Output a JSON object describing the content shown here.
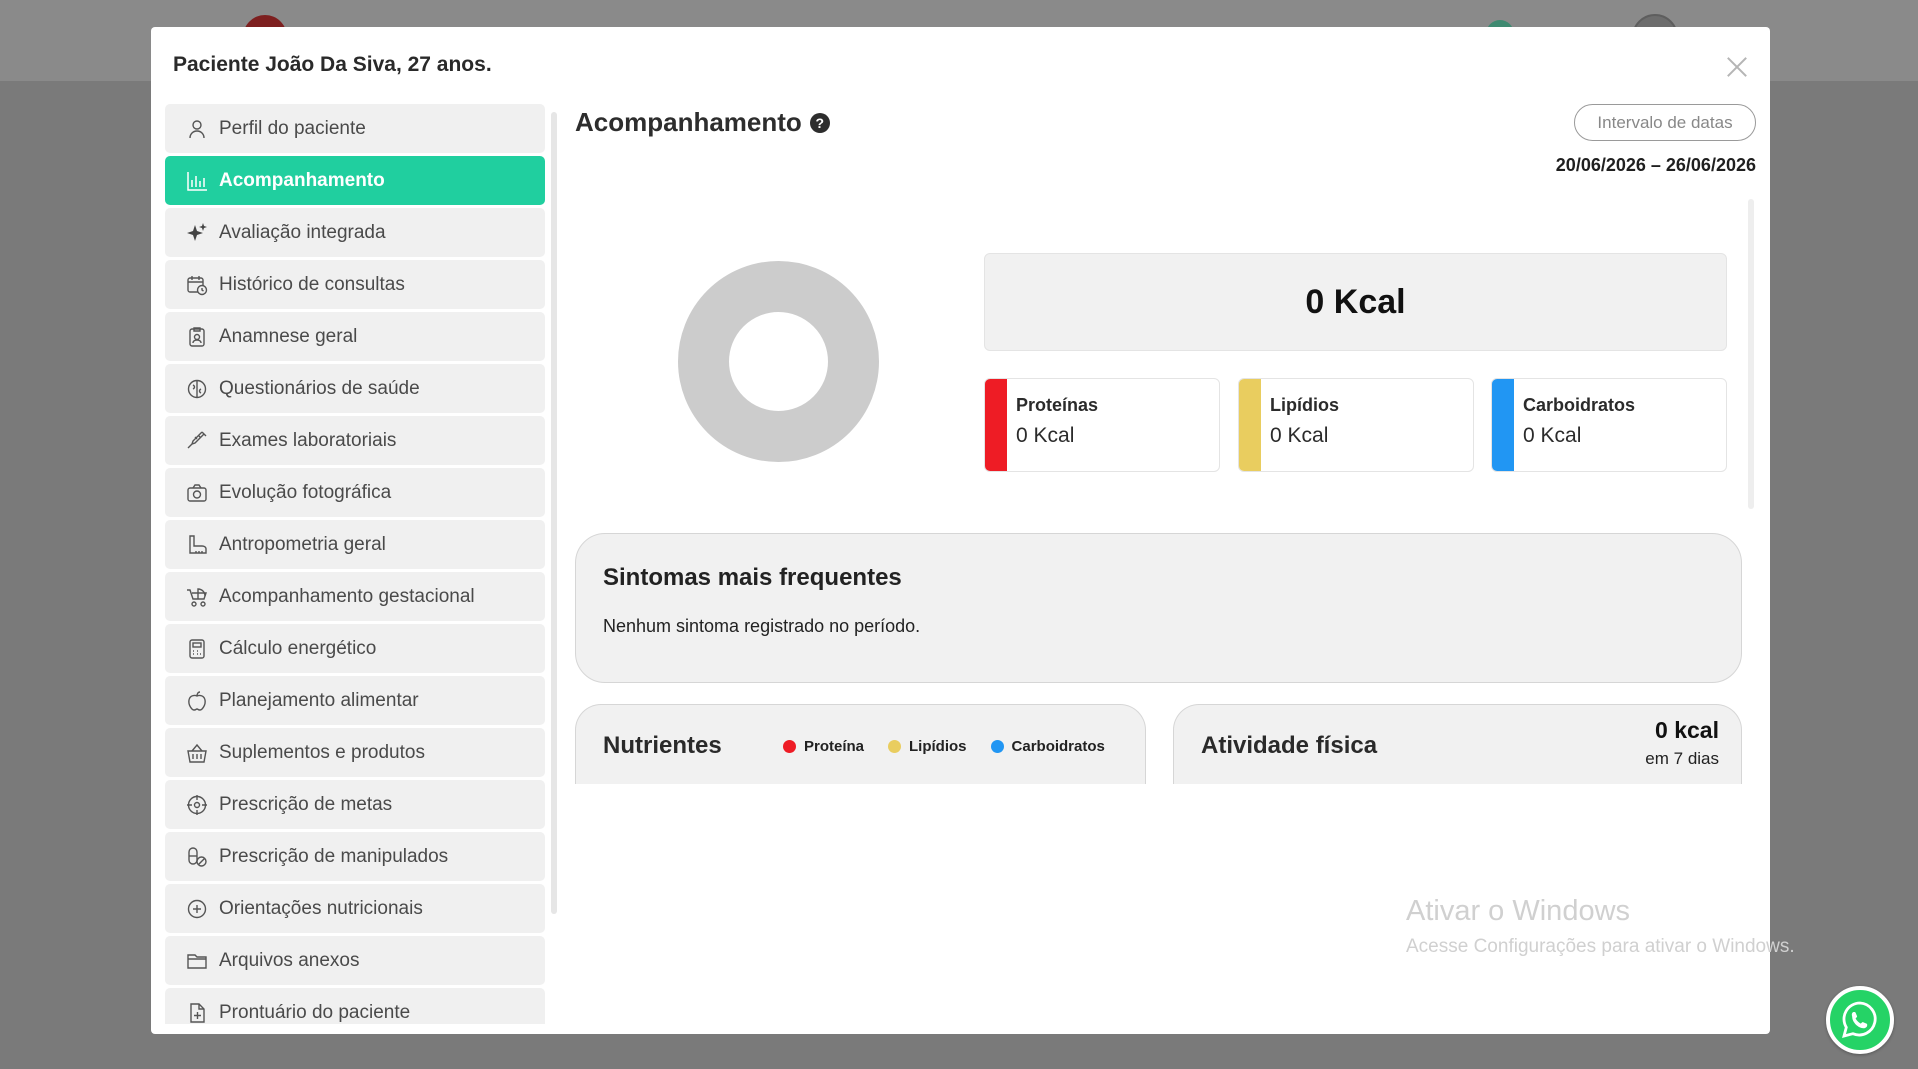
{
  "modal": {
    "title": "Paciente João Da Siva, 27 anos."
  },
  "sidebar": {
    "items": [
      {
        "label": "Perfil do paciente",
        "icon": "user-icon"
      },
      {
        "label": "Acompanhamento",
        "icon": "chart-icon",
        "active": true
      },
      {
        "label": "Avaliação integrada",
        "icon": "sparkle-icon"
      },
      {
        "label": "Histórico de consultas",
        "icon": "calendar-clock-icon"
      },
      {
        "label": "Anamnese geral",
        "icon": "clipboard-user-icon"
      },
      {
        "label": "Questionários de saúde",
        "icon": "brain-icon"
      },
      {
        "label": "Exames laboratoriais",
        "icon": "syringe-icon"
      },
      {
        "label": "Evolução fotográfica",
        "icon": "camera-icon"
      },
      {
        "label": "Antropometria geral",
        "icon": "ruler-foot-icon"
      },
      {
        "label": "Acompanhamento gestacional",
        "icon": "stroller-icon"
      },
      {
        "label": "Cálculo energético",
        "icon": "calculator-icon"
      },
      {
        "label": "Planejamento alimentar",
        "icon": "apple-icon"
      },
      {
        "label": "Suplementos e produtos",
        "icon": "basket-icon"
      },
      {
        "label": "Prescrição de metas",
        "icon": "target-icon"
      },
      {
        "label": "Prescrição de manipulados",
        "icon": "pills-icon"
      },
      {
        "label": "Orientações nutricionais",
        "icon": "plus-circle-icon"
      },
      {
        "label": "Arquivos anexos",
        "icon": "folder-icon"
      },
      {
        "label": "Prontuário do paciente",
        "icon": "file-plus-icon"
      }
    ]
  },
  "main": {
    "title": "Acompanhamento",
    "help_glyph": "?",
    "date_button": "Intervalo de datas",
    "date_range": "20/06/2026 – 26/06/2026",
    "total_kcal": "0 Kcal",
    "macros": [
      {
        "name": "Proteínas",
        "value": "0 Kcal",
        "color": "#ee1c25"
      },
      {
        "name": "Lipídios",
        "value": "0 Kcal",
        "color": "#e9cd5f"
      },
      {
        "name": "Carboidratos",
        "value": "0 Kcal",
        "color": "#2196f3"
      }
    ],
    "symptoms": {
      "title": "Sintomas mais frequentes",
      "text": "Nenhum sintoma registrado no período."
    },
    "nutrients": {
      "title": "Nutrientes",
      "legend": [
        {
          "label": "Proteína",
          "color": "#ee1c25"
        },
        {
          "label": "Lipídios",
          "color": "#e9cd5f"
        },
        {
          "label": "Carboidratos",
          "color": "#2196f3"
        }
      ]
    },
    "activity": {
      "title": "Atividade física",
      "kcal": "0 kcal",
      "period": "em 7 dias"
    }
  },
  "watermark": {
    "line1": "Ativar o Windows",
    "line2": "Acesse Configurações para ativar o Windows."
  },
  "colors": {
    "accent": "#20cf9f",
    "donut": "#cccccc",
    "whatsapp": "#25d366"
  }
}
